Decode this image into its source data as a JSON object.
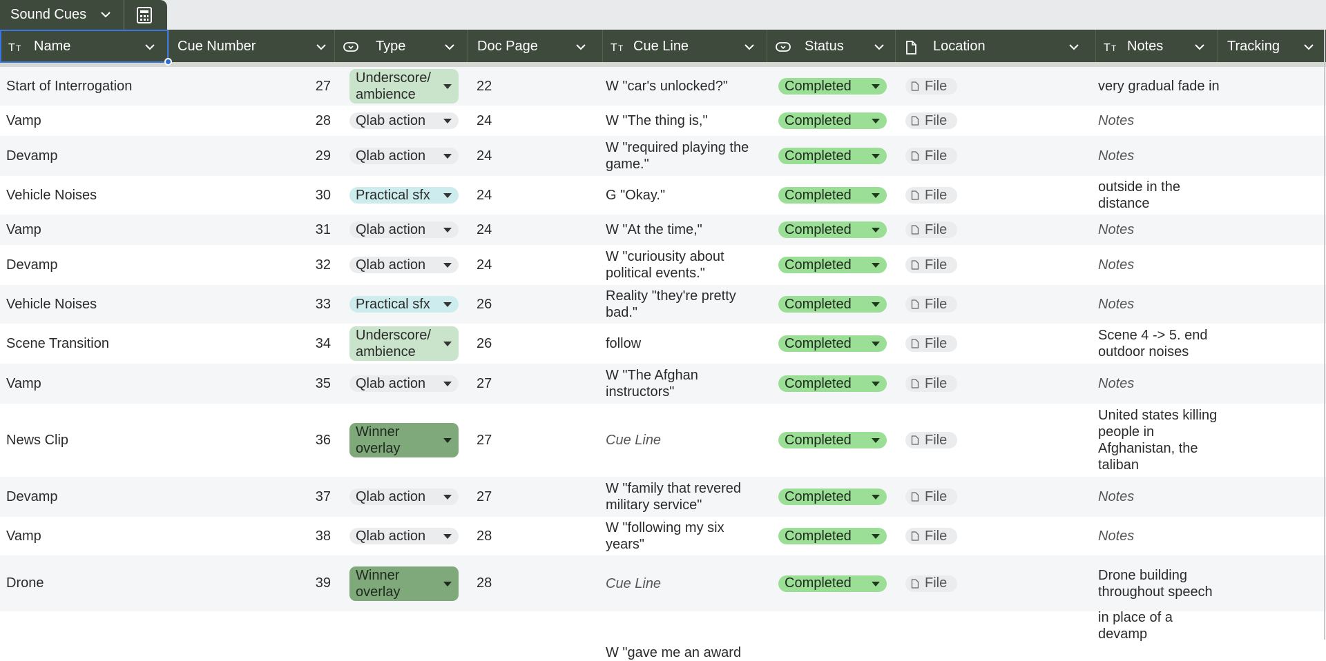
{
  "tab": {
    "title": "Sound Cues"
  },
  "columns": [
    {
      "label": "Name",
      "icon": "text-type-icon"
    },
    {
      "label": "Cue Number",
      "icon": ""
    },
    {
      "label": "Type",
      "icon": "single-select-icon"
    },
    {
      "label": "Doc Page",
      "icon": ""
    },
    {
      "label": "Cue Line",
      "icon": "text-type-icon"
    },
    {
      "label": "Status",
      "icon": "single-select-icon"
    },
    {
      "label": "Location",
      "icon": "file-icon"
    },
    {
      "label": "Notes",
      "icon": "text-type-icon"
    },
    {
      "label": "Tracking",
      "icon": ""
    }
  ],
  "rows": [
    {
      "name": "Start of Interrogation",
      "num": "27",
      "type": "Underscore/ ambience",
      "type_style": "underscore",
      "page": "22",
      "cue": "W \"car's unlocked?\"",
      "status": "Completed",
      "loc": "File",
      "notes": "very gradual fade in",
      "notes_ph": false,
      "cue_ph": false
    },
    {
      "name": "Vamp",
      "num": "28",
      "type": "Qlab action",
      "type_style": "qlab",
      "page": "24",
      "cue": "W \"The thing is,\"",
      "status": "Completed",
      "loc": "File",
      "notes": "Notes",
      "notes_ph": true,
      "cue_ph": false
    },
    {
      "name": "Devamp",
      "num": "29",
      "type": "Qlab action",
      "type_style": "qlab",
      "page": "24",
      "cue": "W \"required playing the game.\"",
      "status": "Completed",
      "loc": "File",
      "notes": "Notes",
      "notes_ph": true,
      "cue_ph": false
    },
    {
      "name": "Vehicle Noises",
      "num": "30",
      "type": "Practical sfx",
      "type_style": "practical",
      "page": "24",
      "cue": "G \"Okay.\"",
      "status": "Completed",
      "loc": "File",
      "notes": "outside in the distance",
      "notes_ph": false,
      "cue_ph": false
    },
    {
      "name": "Vamp",
      "num": "31",
      "type": "Qlab action",
      "type_style": "qlab",
      "page": "24",
      "cue": "W \"At the time,\"",
      "status": "Completed",
      "loc": "File",
      "notes": "Notes",
      "notes_ph": true,
      "cue_ph": false
    },
    {
      "name": "Devamp",
      "num": "32",
      "type": "Qlab action",
      "type_style": "qlab",
      "page": "24",
      "cue": "W \"curiousity about political events.\"",
      "status": "Completed",
      "loc": "File",
      "notes": "Notes",
      "notes_ph": true,
      "cue_ph": false
    },
    {
      "name": "Vehicle Noises",
      "num": "33",
      "type": "Practical sfx",
      "type_style": "practical",
      "page": "26",
      "cue": "Reality \"they're pretty bad.\"",
      "status": "Completed",
      "loc": "File",
      "notes": "Notes",
      "notes_ph": true,
      "cue_ph": false
    },
    {
      "name": "Scene Transition",
      "num": "34",
      "type": "Underscore/ ambience",
      "type_style": "underscore",
      "page": "26",
      "cue": "follow",
      "status": "Completed",
      "loc": "File",
      "notes": "Scene 4 -> 5. end outdoor noises",
      "notes_ph": false,
      "cue_ph": false
    },
    {
      "name": "Vamp",
      "num": "35",
      "type": "Qlab action",
      "type_style": "qlab",
      "page": "27",
      "cue": "W \"The Afghan instructors\"",
      "status": "Completed",
      "loc": "File",
      "notes": "Notes",
      "notes_ph": true,
      "cue_ph": false
    },
    {
      "name": "News Clip",
      "num": "36",
      "type": "Winner overlay",
      "type_style": "winner",
      "page": "27",
      "cue": "Cue Line",
      "status": "Completed",
      "loc": "File",
      "notes": "United states killing people in Afghanistan, the taliban",
      "notes_ph": false,
      "cue_ph": true
    },
    {
      "name": "Devamp",
      "num": "37",
      "type": "Qlab action",
      "type_style": "qlab",
      "page": "27",
      "cue": "W \"family that revered military service\"",
      "status": "Completed",
      "loc": "File",
      "notes": "Notes",
      "notes_ph": true,
      "cue_ph": false
    },
    {
      "name": "Vamp",
      "num": "38",
      "type": "Qlab action",
      "type_style": "qlab",
      "page": "28",
      "cue": "W \"following my six years\"",
      "status": "Completed",
      "loc": "File",
      "notes": "Notes",
      "notes_ph": true,
      "cue_ph": false
    },
    {
      "name": "Drone",
      "num": "39",
      "type": "Winner overlay",
      "type_style": "winner",
      "page": "28",
      "cue": "Cue Line",
      "status": "Completed",
      "loc": "File",
      "notes": "Drone building throughout speech",
      "notes_ph": false,
      "cue_ph": true
    },
    {
      "name": "",
      "num": "",
      "type": "",
      "type_style": "",
      "page": "",
      "cue": "W \"gave me an award",
      "status": "",
      "loc": "",
      "notes": "in place of a devamp",
      "notes_ph": false,
      "cue_ph": false
    }
  ],
  "colors": {
    "header_bg": "#3e4a3c",
    "status_bg": "#9bdf97",
    "selection": "#3a78e0"
  }
}
